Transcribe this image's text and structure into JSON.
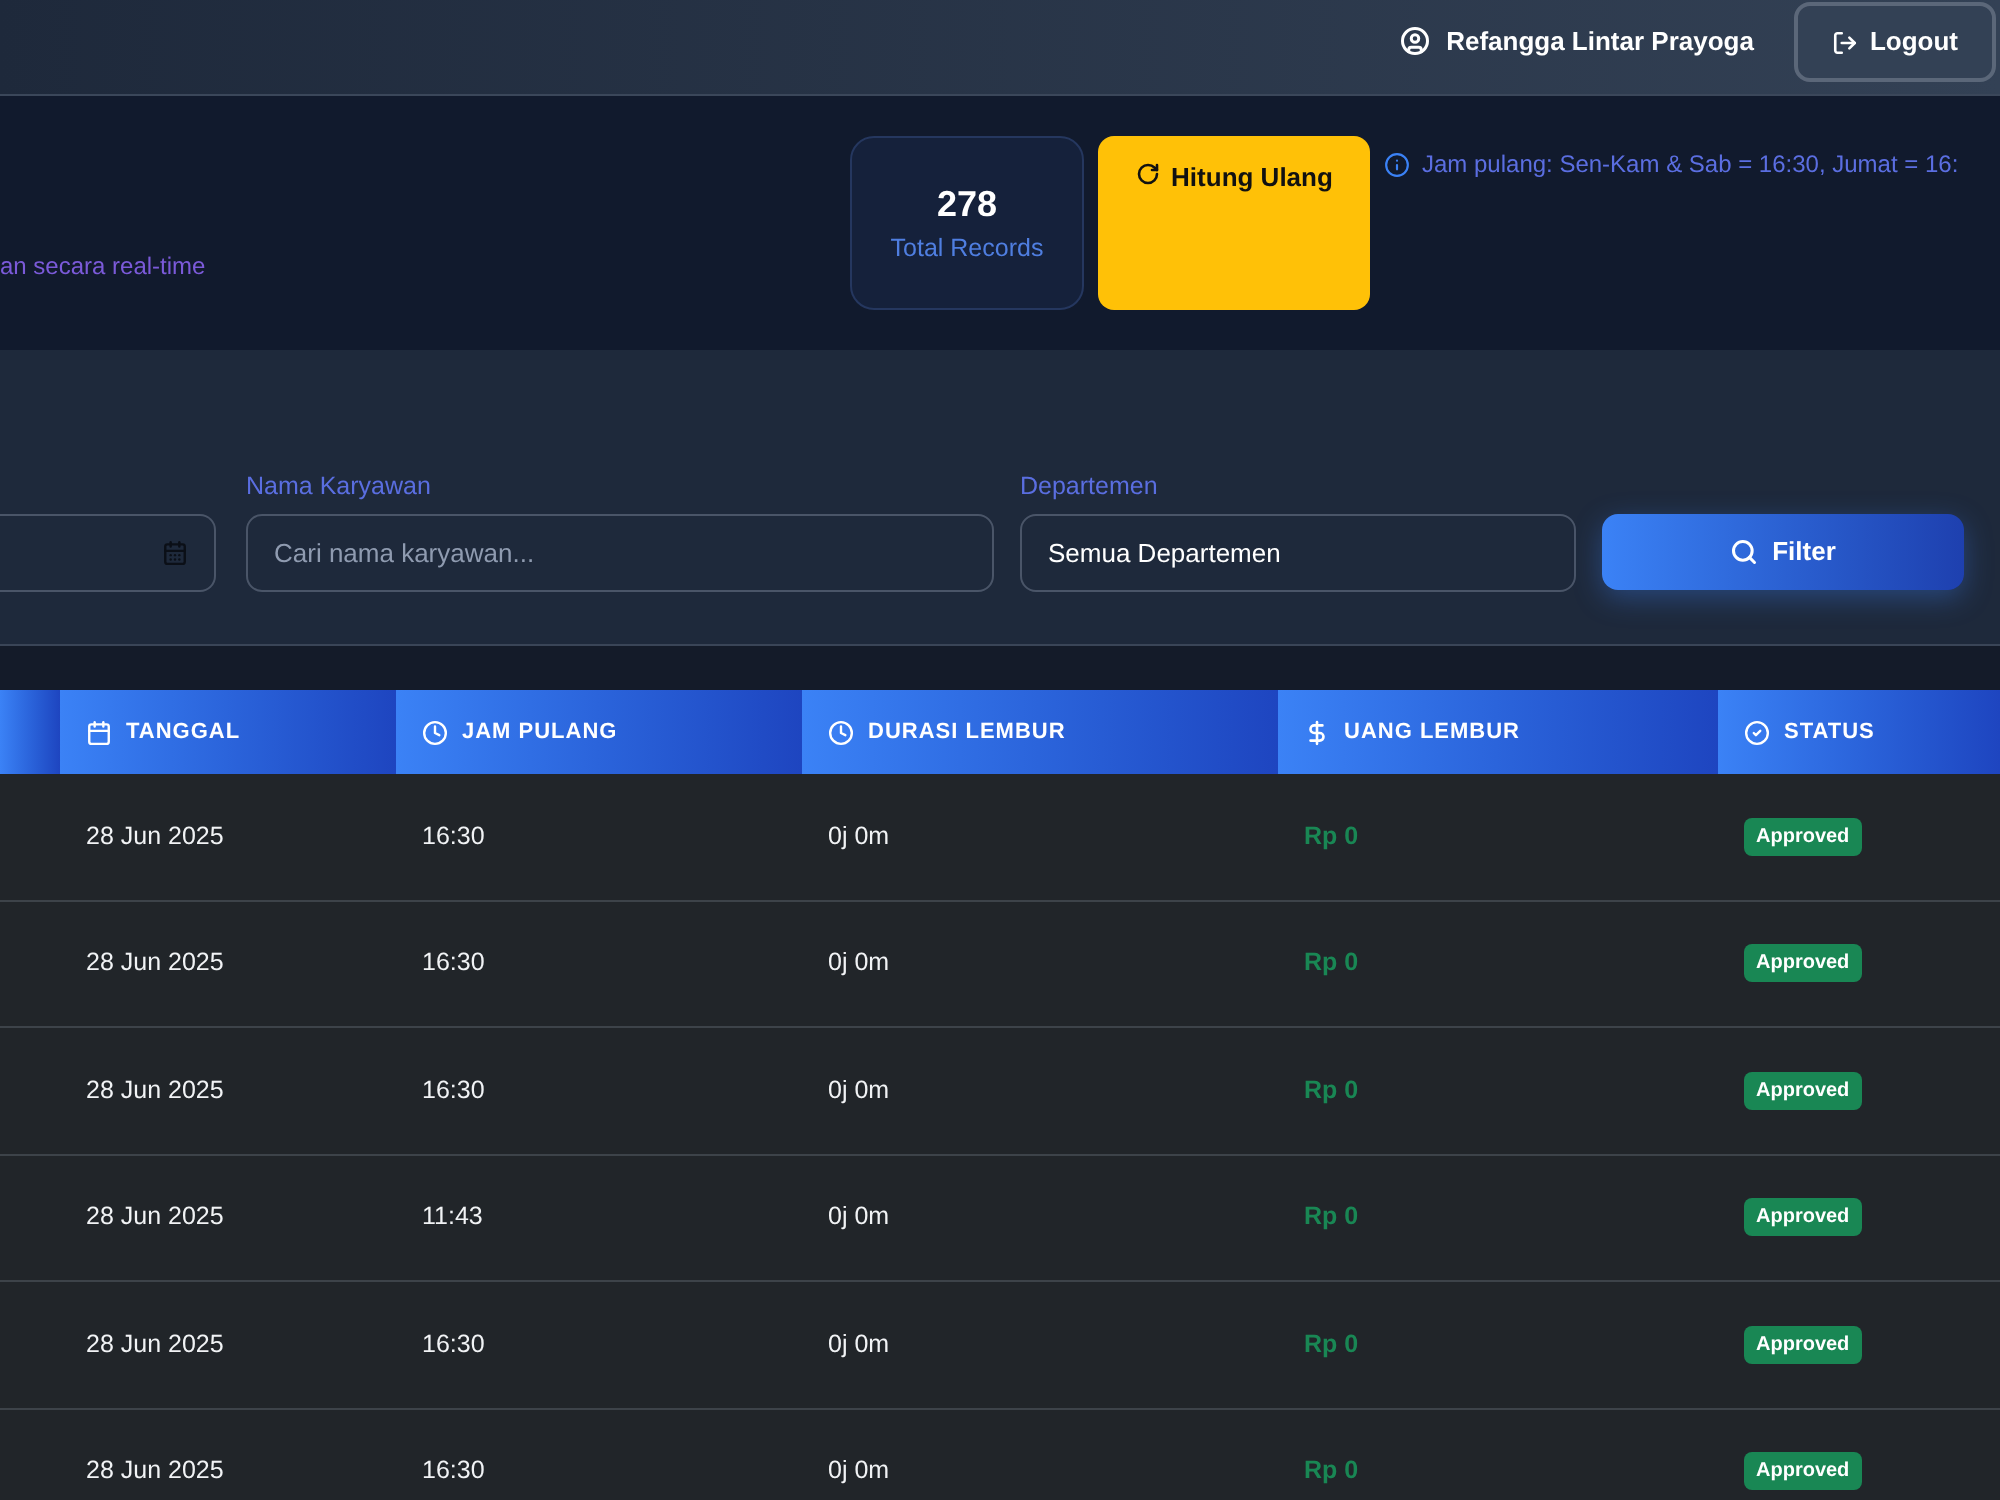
{
  "top_bar": {
    "user_name": "Refangga Lintar Prayoga",
    "logout_label": "Logout"
  },
  "header": {
    "subtitle": "an secara real-time",
    "stats": {
      "value": "278",
      "label": "Total Records"
    },
    "recalculate_label": "Hitung Ulang",
    "info": "Jam pulang: Sen-Kam & Sab = 16:30, Jumat = 16:"
  },
  "filters": {
    "fields": [
      {
        "kind": "date"
      },
      {
        "kind": "text",
        "label": "Nama Karyawan",
        "placeholder": "Cari nama karyawan..."
      },
      {
        "kind": "select",
        "label": "Departemen",
        "value": "Semua Departemen"
      }
    ],
    "button_label": "Filter"
  },
  "table": {
    "columns": [
      {
        "kind": "cut"
      },
      {
        "kind": "date",
        "label": "TANGGAL"
      },
      {
        "kind": "time",
        "label": "JAM PULANG"
      },
      {
        "kind": "duration",
        "label": "DURASI LEMBUR"
      },
      {
        "kind": "money",
        "label": "UANG LEMBUR"
      },
      {
        "kind": "status",
        "label": "STATUS"
      }
    ],
    "rows": [
      [
        "",
        "28 Jun 2025",
        "16:30",
        "0j 0m",
        "Rp 0",
        "Approved"
      ],
      [
        "",
        "28 Jun 2025",
        "16:30",
        "0j 0m",
        "Rp 0",
        "Approved"
      ],
      [
        "",
        "28 Jun 2025",
        "16:30",
        "0j 0m",
        "Rp 0",
        "Approved"
      ],
      [
        "",
        "28 Jun 2025",
        "11:43",
        "0j 0m",
        "Rp 0",
        "Approved"
      ],
      [
        "",
        "28 Jun 2025",
        "16:30",
        "0j 0m",
        "Rp 0",
        "Approved"
      ],
      [
        "",
        "28 Jun 2025",
        "16:30",
        "0j 0m",
        "Rp 0",
        "Approved"
      ]
    ]
  }
}
